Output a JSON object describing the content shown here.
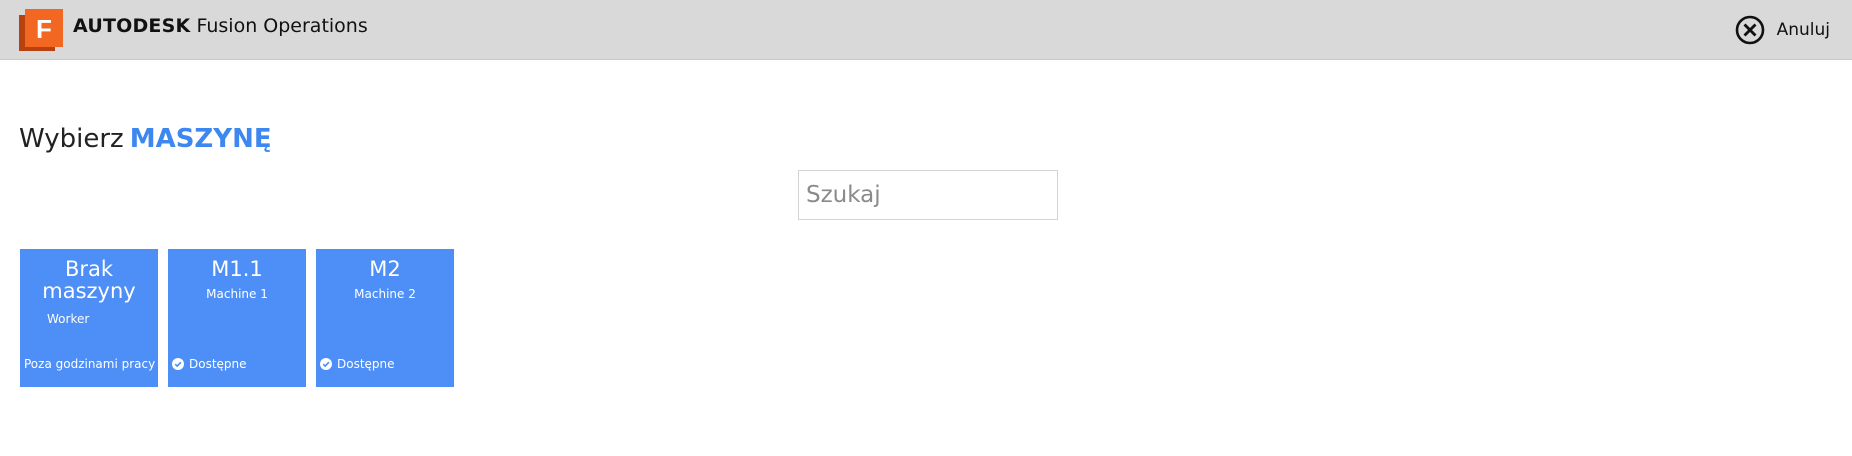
{
  "header": {
    "brand_bold": "AUTODESK",
    "brand_regular": "Fusion Operations",
    "logo_letter": "F",
    "logo_icon": "fusion-logo-icon",
    "cancel_label": "Anuluj",
    "cancel_icon": "close-circle-icon"
  },
  "heading": {
    "prefix": "Wybierz",
    "accent": "MASZYNĘ"
  },
  "search": {
    "placeholder": "Szukaj",
    "value": ""
  },
  "machines": [
    {
      "title_line1": "Brak",
      "title_line2": "maszyny",
      "subtitle": "Worker",
      "status": "Poza godzinami pracy"
    },
    {
      "title": "M1.1",
      "subtitle": "Machine 1",
      "status": "Dostępne",
      "status_icon": "check-circle-icon"
    },
    {
      "title": "M2",
      "subtitle": "Machine 2",
      "status": "Dostępne",
      "status_icon": "check-circle-icon"
    }
  ],
  "colors": {
    "accent": "#3d87f0",
    "tile": "#4d8ef7",
    "topbar": "#d9d9d9",
    "logo_orange": "#f26722"
  }
}
